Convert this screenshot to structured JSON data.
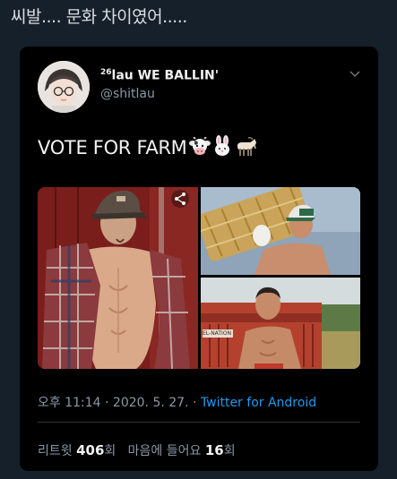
{
  "caption": "씨발.... 문화 차이였어.....",
  "tweet": {
    "name_superscript": "26",
    "name": "lau WE BALLIN'",
    "handle": "@shitlau",
    "text": "VOTE FOR FARM",
    "emojis": [
      "cow-face-emoji",
      "rabbit-face-emoji",
      "goat-emoji"
    ],
    "time": "오후 11:14",
    "date": "2020. 5. 27.",
    "source": "Twitter for Android",
    "separator": "·",
    "retweet_label": "리트윗",
    "retweet_count": "406",
    "retweet_unit": "회",
    "like_label": "마음에 들어요",
    "like_count": "16",
    "like_unit": "회"
  },
  "media_sign_text": "EL-NATION",
  "colors": {
    "background": "#15202b",
    "card": "#000000",
    "link": "#1d9bf0",
    "muted": "#8b98a5"
  }
}
